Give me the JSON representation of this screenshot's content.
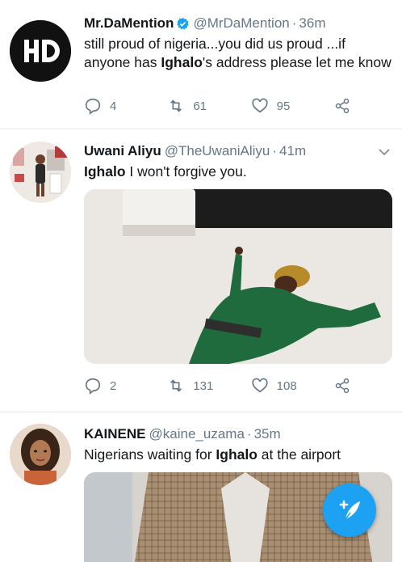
{
  "tweets": [
    {
      "name": "Mr.DaMention",
      "verified": true,
      "handle": "@MrDaMention",
      "time": "36m",
      "text_parts": [
        "still proud of nigeria...you did us proud ...if anyone has ",
        "Ighalo",
        "'s address please let me know"
      ],
      "replies": "4",
      "retweets": "61",
      "likes": "95",
      "avatar_text": "HD"
    },
    {
      "name": "Uwani Aliyu",
      "verified": false,
      "handle": "@TheUwaniAliyu",
      "time": "41m",
      "text_parts": [
        "",
        "Ighalo",
        " I won't forgive you."
      ],
      "replies": "2",
      "retweets": "131",
      "likes": "108"
    },
    {
      "name": "KAINENE",
      "verified": false,
      "handle": "@kaine_uzama",
      "time": "35m",
      "text_parts": [
        "Nigerians waiting for ",
        "Ighalo",
        " at the airport"
      ]
    }
  ],
  "icons": {
    "reply": "reply-icon",
    "retweet": "retweet-icon",
    "like": "heart-icon",
    "share": "share-icon",
    "compose": "compose-tweet-icon"
  },
  "colors": {
    "accent": "#1da1f2",
    "secondary_text": "#657786",
    "divider": "#e1e8ed"
  }
}
